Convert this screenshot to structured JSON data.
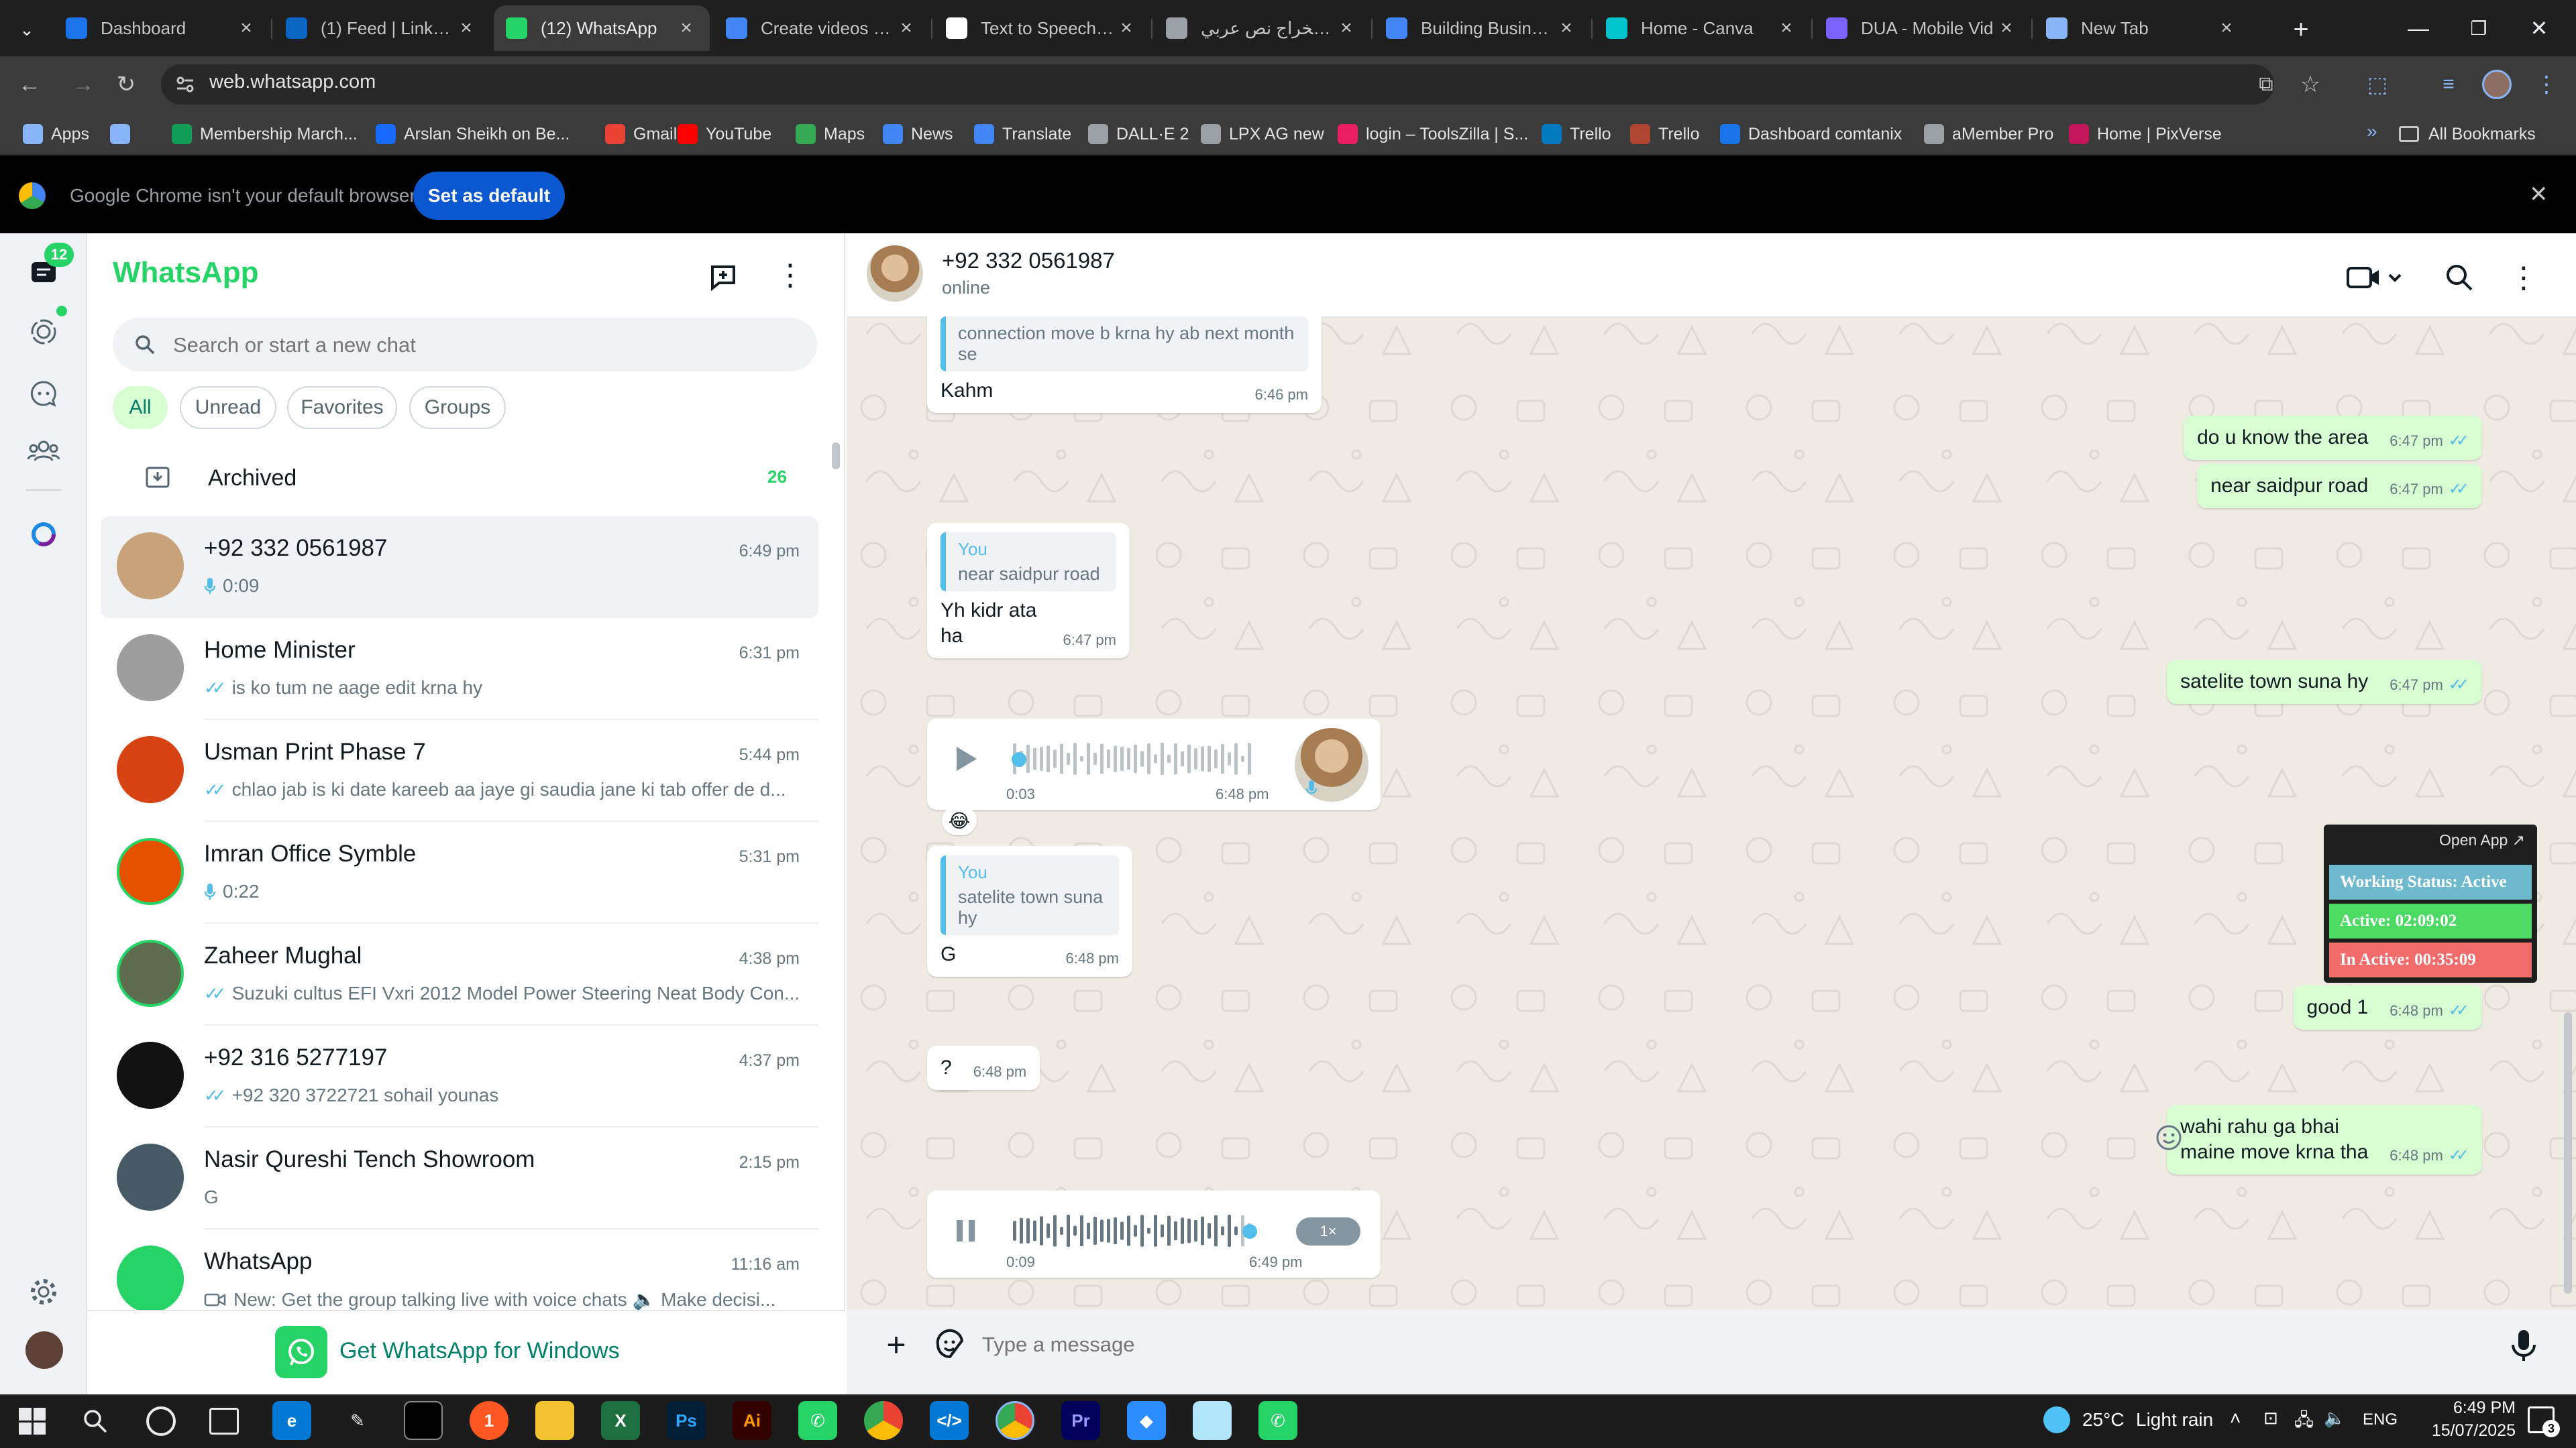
{
  "browser": {
    "tabs": [
      {
        "title": "Dashboard",
        "icon": "dashboard-favicon",
        "color": "#1a73e8"
      },
      {
        "title": "(1) Feed | LinkedIn",
        "icon": "linkedin-favicon",
        "color": "#0a66c2"
      },
      {
        "title": "(12) WhatsApp",
        "icon": "whatsapp-favicon",
        "color": "#25d366"
      },
      {
        "title": "Create videos | Fr",
        "icon": "docs-favicon",
        "color": "#4285f4"
      },
      {
        "title": "Text to Speech | E",
        "icon": "elevenlabs-favicon",
        "color": "#ffffff"
      },
      {
        "title": "استخراج نص عربي",
        "icon": "ocr-favicon",
        "color": "#9aa0a6"
      },
      {
        "title": "Building Business",
        "icon": "docs-favicon",
        "color": "#4285f4"
      },
      {
        "title": "Home - Canva",
        "icon": "canva-favicon",
        "color": "#00c4cc"
      },
      {
        "title": "DUA - Mobile Vid",
        "icon": "clipchamp-favicon",
        "color": "#7b61ff"
      },
      {
        "title": "New Tab",
        "icon": "chrome-favicon",
        "color": "#8ab4f8"
      }
    ],
    "url": "web.whatsapp.com",
    "bookmarks": [
      {
        "label": "Apps",
        "icon": "apps-grid-icon",
        "color": "#8ab4f8"
      },
      {
        "label": "",
        "icon": "grid-icon",
        "color": "#8ab4f8"
      },
      {
        "label": "Membership March...",
        "icon": "sheets-icon",
        "color": "#0f9d58"
      },
      {
        "label": "Arslan Sheikh on Be...",
        "icon": "behance-icon",
        "color": "#1769ff"
      },
      {
        "label": "Gmail",
        "icon": "gmail-icon",
        "color": "#ea4335"
      },
      {
        "label": "YouTube",
        "icon": "youtube-icon",
        "color": "#ff0000"
      },
      {
        "label": "Maps",
        "icon": "maps-icon",
        "color": "#34a853"
      },
      {
        "label": "News",
        "icon": "news-icon",
        "color": "#4285f4"
      },
      {
        "label": "Translate",
        "icon": "translate-icon",
        "color": "#4285f4"
      },
      {
        "label": "DALL·E 2",
        "icon": "openai-icon",
        "color": "#9aa0a6"
      },
      {
        "label": "LPX AG new",
        "icon": "dots-icon",
        "color": "#9aa0a6"
      },
      {
        "label": "login – ToolsZilla | S...",
        "icon": "toolszilla-icon",
        "color": "#e91e63"
      },
      {
        "label": "Trello",
        "icon": "trello-icon",
        "color": "#0079bf"
      },
      {
        "label": "Trello",
        "icon": "trello-icon",
        "color": "#b04632"
      },
      {
        "label": "Dashboard comtanix",
        "icon": "dashboard-favicon",
        "color": "#1a73e8"
      },
      {
        "label": "aMember Pro",
        "icon": "amember-icon",
        "color": "#9aa0a6"
      },
      {
        "label": "Home | PixVerse",
        "icon": "pixverse-icon",
        "color": "#c2185b"
      }
    ],
    "all_bookmarks": "All Bookmarks",
    "banner_text": "Google Chrome isn't your default browser",
    "banner_button": "Set as default"
  },
  "whatsapp": {
    "brand": "WhatsApp",
    "unread_badge": "12",
    "search_placeholder": "Search or start a new chat",
    "filters": [
      "All",
      "Unread",
      "Favorites",
      "Groups"
    ],
    "archived_label": "Archived",
    "archived_count": "26",
    "chats": [
      {
        "name": "+92 332 0561987",
        "time": "6:49 pm",
        "preview": "0:09",
        "type": "voice",
        "avatar_color": "#c8a27a"
      },
      {
        "name": "Home Minister",
        "time": "6:31 pm",
        "preview": "is ko tum ne aage edit krna hy",
        "type": "read",
        "avatar_color": "#9e9e9e"
      },
      {
        "name": "Usman Print Phase 7",
        "time": "5:44 pm",
        "preview": "chlao jab is ki date kareeb aa jaye gi  saudia jane ki tab offer de d...",
        "type": "read",
        "avatar_color": "#d84315"
      },
      {
        "name": "Imran Office Symble",
        "time": "5:31 pm",
        "preview": "0:22",
        "type": "voice",
        "avatar_color": "#e65100"
      },
      {
        "name": "Zaheer Mughal",
        "time": "4:38 pm",
        "preview": "Suzuki cultus EFI Vxri 2012 Model Power Steering Neat Body Con...",
        "type": "read",
        "avatar_color": "#5d6d4e"
      },
      {
        "name": "+92 316 5277197",
        "time": "4:37 pm",
        "preview": "+92 320 3722721  sohail younas",
        "type": "read",
        "avatar_color": "#111111"
      },
      {
        "name": "Nasir Qureshi Tench Showroom",
        "time": "2:15 pm",
        "preview": "G",
        "type": "plain",
        "avatar_color": "#455a64"
      },
      {
        "name": "WhatsApp",
        "time": "11:16 am",
        "preview": "New: Get the group talking live with voice chats 🔈 Make decisi...",
        "type": "video",
        "avatar_color": "#25d366"
      }
    ],
    "get_windows": "Get WhatsApp for Windows",
    "contact": {
      "name": "+92 332 0561987",
      "status": "online"
    },
    "messages": [
      {
        "dir": "in",
        "quote_text": "connection move b krna hy ab next month se",
        "text": "Kahm",
        "time": "6:46 pm"
      },
      {
        "dir": "out",
        "text": "do u know the area",
        "time": "6:47 pm"
      },
      {
        "dir": "out",
        "text": "near saidpur road",
        "time": "6:47 pm"
      },
      {
        "dir": "in",
        "quote_who": "You",
        "quote_text": "near saidpur road",
        "text": "Yh kidr ata ha",
        "time": "6:47 pm"
      },
      {
        "dir": "out",
        "text": "satelite town suna hy",
        "time": "6:47 pm"
      },
      {
        "dir": "in",
        "voice_duration": "0:03",
        "time": "6:48 pm",
        "reaction": "😂"
      },
      {
        "dir": "in",
        "quote_who": "You",
        "quote_text": "satelite town suna hy",
        "text": "G",
        "time": "6:48 pm"
      },
      {
        "dir": "out",
        "text": "good 1",
        "time": "6:48 pm"
      },
      {
        "dir": "in",
        "text": "?",
        "time": "6:48 pm"
      },
      {
        "dir": "out",
        "text": "wahi rahu ga bhai\nmaine move krna tha",
        "time": "6:48 pm"
      },
      {
        "dir": "in",
        "voice_duration": "0:09",
        "time": "6:49 pm",
        "speed": "1×"
      }
    ],
    "composer_placeholder": "Type a message"
  },
  "status_widget": {
    "open_app": "Open App ↗",
    "working": "Working Status: Active",
    "active": "Active: 02:09:02",
    "inactive": "In Active: 00:35:09"
  },
  "taskbar": {
    "weather_temp": "25°C",
    "weather_text": "Light rain",
    "lang": "ENG",
    "time": "6:49 PM",
    "date": "15/07/2025",
    "notif": "3"
  }
}
